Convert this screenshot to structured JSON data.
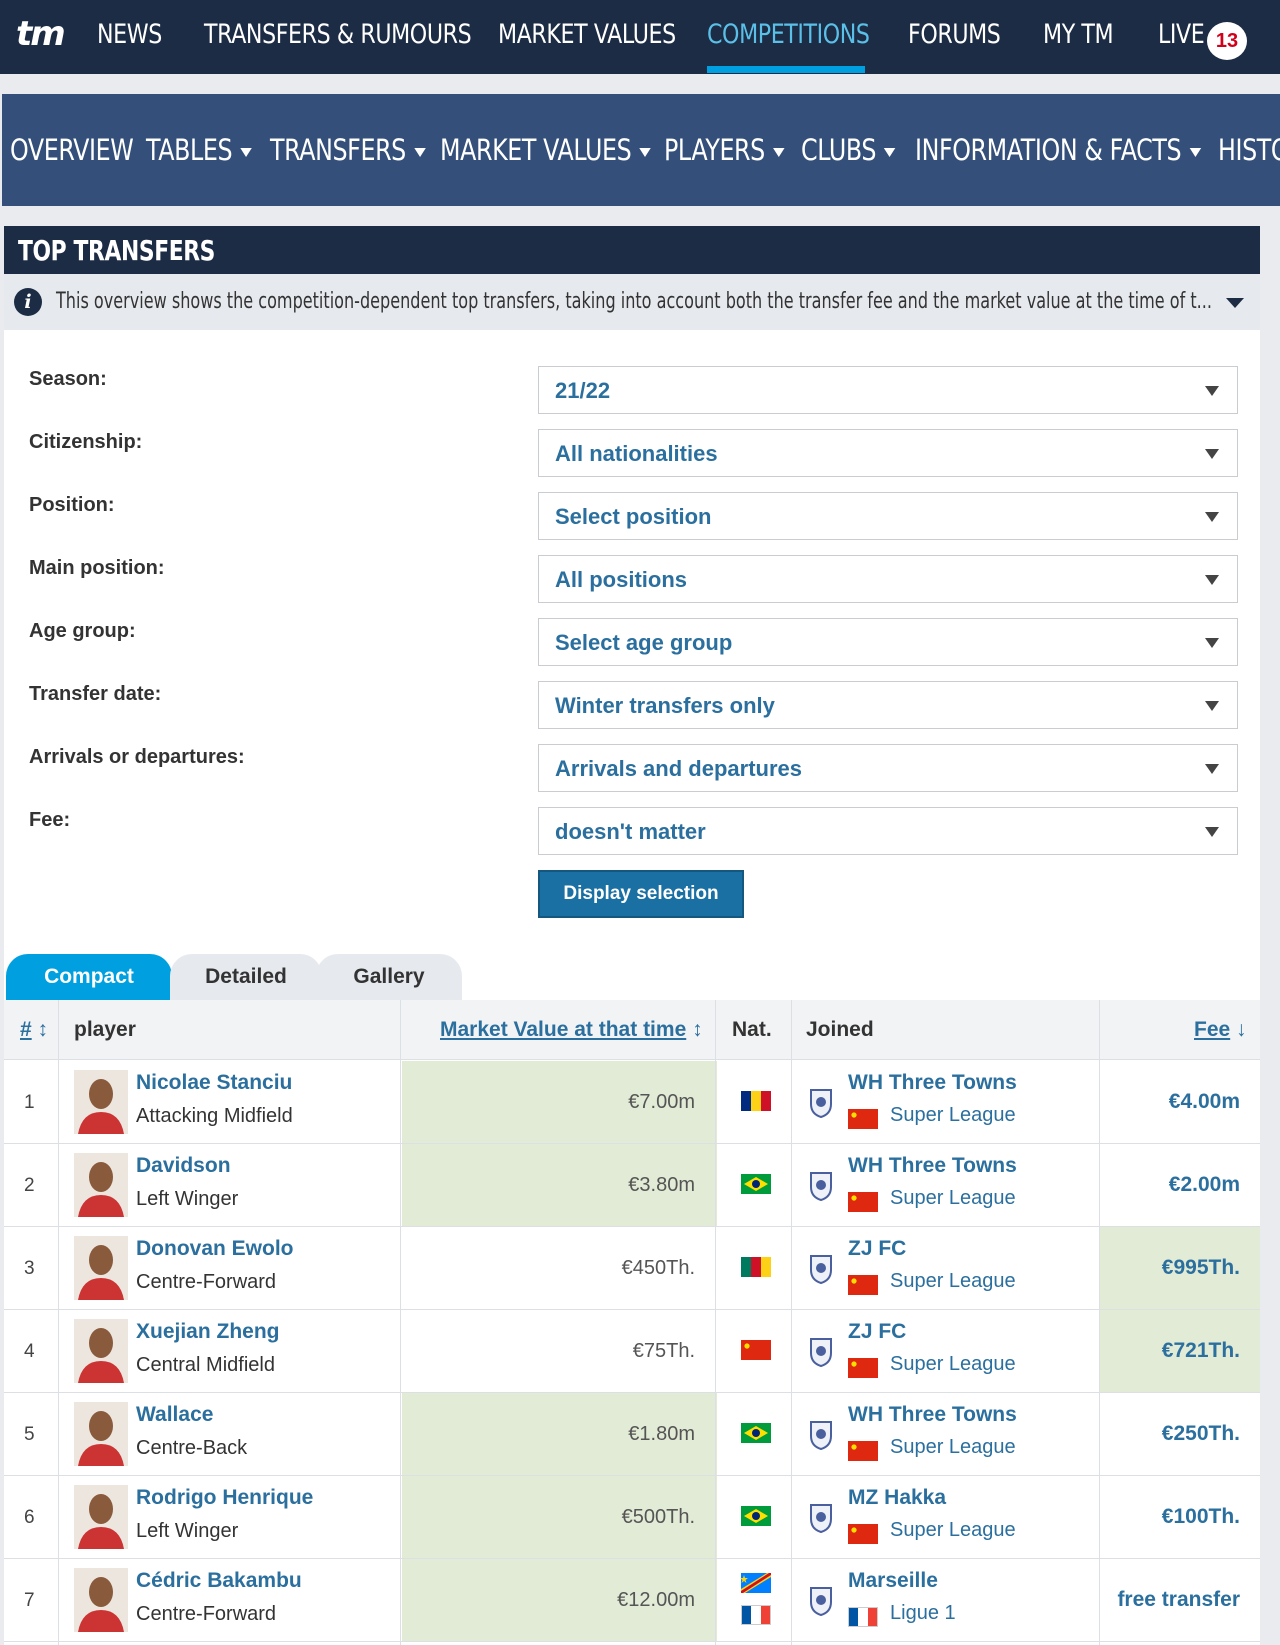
{
  "topnav": {
    "logo": "tm",
    "items": [
      "NEWS",
      "TRANSFERS & RUMOURS",
      "MARKET VALUES",
      "COMPETITIONS",
      "FORUMS",
      "MY TM",
      "LIVE"
    ],
    "live_count": "13"
  },
  "subnav": {
    "items": [
      "OVERVIEW",
      "TABLES",
      "TRANSFERS",
      "MARKET VALUES",
      "PLAYERS",
      "CLUBS",
      "INFORMATION & FACTS",
      "HISTO"
    ]
  },
  "box": {
    "title": "TOP TRANSFERS",
    "info": "This overview shows the competition-dependent top transfers, taking into account both the transfer fee and the market value at the time of t..."
  },
  "form": {
    "fields": [
      {
        "label": "Season:",
        "value": "21/22"
      },
      {
        "label": "Citizenship:",
        "value": "All nationalities"
      },
      {
        "label": "Position:",
        "value": "Select position"
      },
      {
        "label": "Main position:",
        "value": "All positions"
      },
      {
        "label": "Age group:",
        "value": "Select age group"
      },
      {
        "label": "Transfer date:",
        "value": "Winter transfers only"
      },
      {
        "label": "Arrivals or departures:",
        "value": "Arrivals and departures"
      },
      {
        "label": "Fee:",
        "value": "doesn't matter"
      }
    ],
    "submit": "Display selection"
  },
  "tabs": [
    "Compact",
    "Detailed",
    "Gallery"
  ],
  "table": {
    "headers": {
      "num": "#",
      "player": "player",
      "mv": "Market Value at that time",
      "nat": "Nat.",
      "joined": "Joined",
      "fee": "Fee"
    },
    "rows": [
      {
        "num": "1",
        "name": "Nicolae Stanciu",
        "pos": "Attacking Midfield",
        "mv": "€7.00m",
        "nat": [
          "romania"
        ],
        "club": "WH Three Towns",
        "league": "Super League",
        "lflag": "china",
        "fee": "€4.00m",
        "mv_hl": true,
        "fee_hl": false
      },
      {
        "num": "2",
        "name": "Davidson",
        "pos": "Left Winger",
        "mv": "€3.80m",
        "nat": [
          "brazil"
        ],
        "club": "WH Three Towns",
        "league": "Super League",
        "lflag": "china",
        "fee": "€2.00m",
        "mv_hl": true,
        "fee_hl": false
      },
      {
        "num": "3",
        "name": "Donovan Ewolo",
        "pos": "Centre-Forward",
        "mv": "€450Th.",
        "nat": [
          "cameroon"
        ],
        "club": "ZJ FC",
        "league": "Super League",
        "lflag": "china",
        "fee": "€995Th.",
        "mv_hl": false,
        "fee_hl": true
      },
      {
        "num": "4",
        "name": "Xuejian Zheng",
        "pos": "Central Midfield",
        "mv": "€75Th.",
        "nat": [
          "china"
        ],
        "club": "ZJ FC",
        "league": "Super League",
        "lflag": "china",
        "fee": "€721Th.",
        "mv_hl": false,
        "fee_hl": true
      },
      {
        "num": "5",
        "name": "Wallace",
        "pos": "Centre-Back",
        "mv": "€1.80m",
        "nat": [
          "brazil"
        ],
        "club": "WH Three Towns",
        "league": "Super League",
        "lflag": "china",
        "fee": "€250Th.",
        "mv_hl": true,
        "fee_hl": false
      },
      {
        "num": "6",
        "name": "Rodrigo Henrique",
        "pos": "Left Winger",
        "mv": "€500Th.",
        "nat": [
          "brazil"
        ],
        "club": "MZ Hakka",
        "league": "Super League",
        "lflag": "china",
        "fee": "€100Th.",
        "mv_hl": true,
        "fee_hl": false
      },
      {
        "num": "7",
        "name": "Cédric Bakambu",
        "pos": "Centre-Forward",
        "mv": "€12.00m",
        "nat": [
          "dr-congo",
          "france"
        ],
        "club": "Marseille",
        "league": "Ligue 1",
        "lflag": "france",
        "fee": "free transfer",
        "mv_hl": true,
        "fee_hl": false
      }
    ]
  },
  "colors": {
    "navy": "#1d2c45",
    "subnav": "#34507a",
    "accent": "#00a0e0",
    "link": "#2b6f9e",
    "highlight": "#e2ebd5"
  }
}
